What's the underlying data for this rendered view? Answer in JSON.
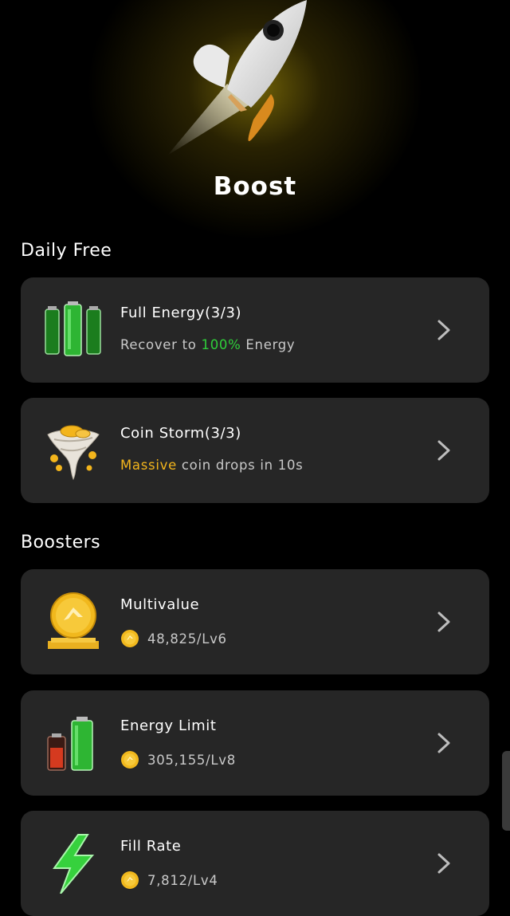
{
  "page": {
    "title": "Boost"
  },
  "daily_free": {
    "heading": "Daily Free",
    "items": [
      {
        "icon": "battery-full-icon",
        "title": "Full Energy(3/3)",
        "sub_pre": "Recover to ",
        "sub_highlight": "100%",
        "sub_post": " Energy"
      },
      {
        "icon": "coin-storm-icon",
        "title": "Coin Storm(3/3)",
        "sub_highlight": "Massive",
        "sub_post": " coin drops in 10s"
      }
    ]
  },
  "boosters": {
    "heading": "Boosters",
    "items": [
      {
        "icon": "gold-coin-icon",
        "title": "Multivalue",
        "cost": "48,825/Lv6"
      },
      {
        "icon": "battery-upgrade-icon",
        "title": "Energy Limit",
        "cost": "305,155/Lv8"
      },
      {
        "icon": "lightning-icon",
        "title": "Fill Rate",
        "cost": "7,812/Lv4"
      }
    ]
  },
  "colors": {
    "highlight_green": "#2fcf3a",
    "highlight_gold": "#f3b51c",
    "card_bg": "#262626"
  }
}
